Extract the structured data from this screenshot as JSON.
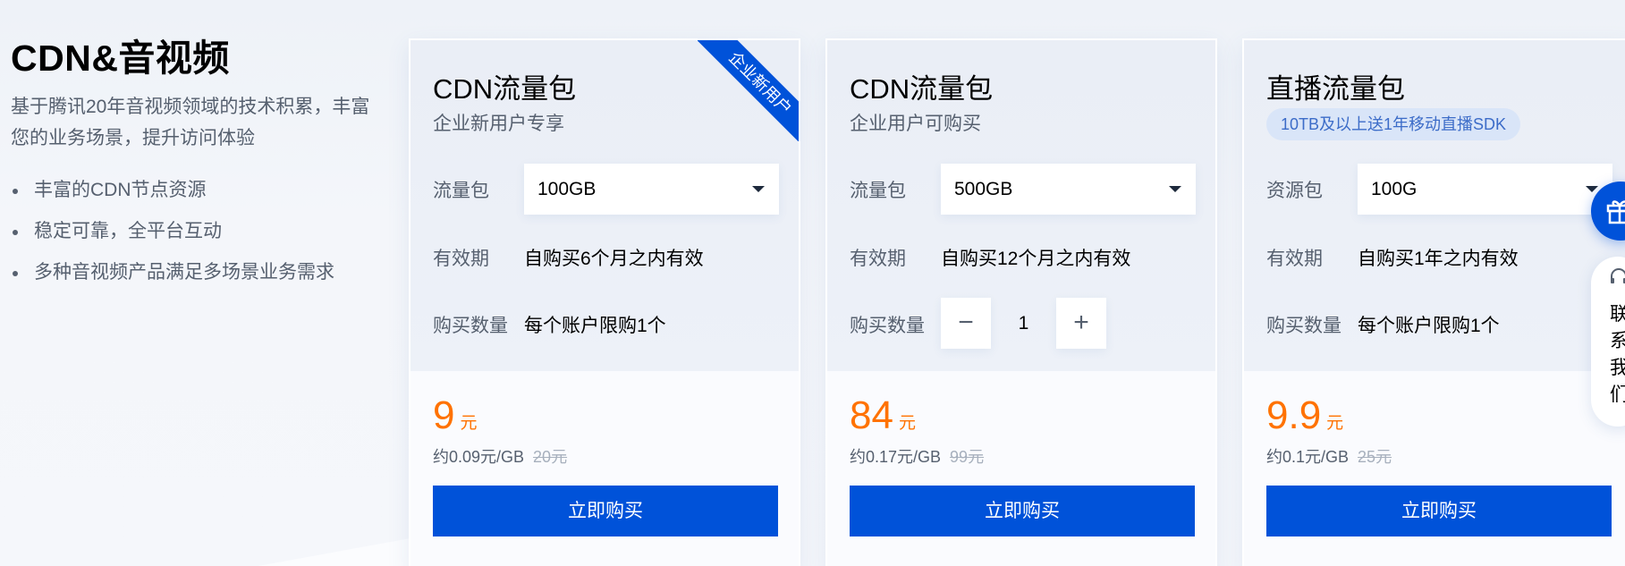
{
  "intro": {
    "title": "CDN&音视频",
    "desc": "基于腾讯20年音视频领域的技术积累，丰富您的业务场景，提升访问体验",
    "bullets": [
      "丰富的CDN节点资源",
      "稳定可靠，全平台互动",
      "多种音视频产品满足多场景业务需求"
    ]
  },
  "cards": [
    {
      "title": "CDN流量包",
      "subtitle": "企业新用户专享",
      "ribbon": "企业新用户",
      "select_label": "流量包",
      "select_value": "100GB",
      "validity_label": "有效期",
      "validity_value": "自购买6个月之内有效",
      "qty_label": "购买数量",
      "qty_value": "每个账户限购1个",
      "price": "9",
      "price_unit": "元",
      "unit_price": "约0.09元/GB",
      "original_price": "20元",
      "buy_label": "立即购买"
    },
    {
      "title": "CDN流量包",
      "subtitle": "企业用户可购买",
      "select_label": "流量包",
      "select_value": "500GB",
      "validity_label": "有效期",
      "validity_value": "自购买12个月之内有效",
      "qty_label": "购买数量",
      "qty_stepper_value": "1",
      "qty_minus": "−",
      "qty_plus": "+",
      "price": "84",
      "price_unit": "元",
      "unit_price": "约0.17元/GB",
      "original_price": "99元",
      "buy_label": "立即购买"
    },
    {
      "title": "直播流量包",
      "tag": "10TB及以上送1年移动直播SDK",
      "select_label": "资源包",
      "select_value": "100G",
      "validity_label": "有效期",
      "validity_value": "自购买1年之内有效",
      "qty_label": "购买数量",
      "qty_value": "每个账户限购1个",
      "price": "9.9",
      "price_unit": "元",
      "unit_price": "约0.1元/GB",
      "original_price": "25元",
      "buy_label": "立即购买"
    }
  ],
  "floating": {
    "gift_icon": "gift-icon",
    "contact_icon": "headset-icon",
    "contact_text": "联系我们"
  },
  "colors": {
    "primary": "#0052d9",
    "price": "#ff7200",
    "muted": "#56606f"
  }
}
